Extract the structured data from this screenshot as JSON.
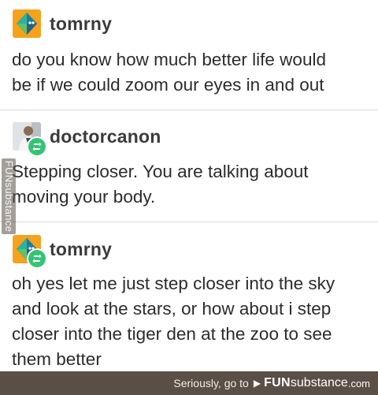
{
  "posts": [
    {
      "username": "tomrny",
      "lines": [
        "do you know how much better life would",
        "be if we could zoom our eyes in and out"
      ]
    },
    {
      "username": "doctorcanon",
      "lines": [
        "Stepping closer. You are talking about",
        "moving your body."
      ]
    },
    {
      "username": "tomrny",
      "lines": [
        "oh yes let me just step closer into the sky",
        "and look at the stars, or how about i step",
        "closer into the tiger den at the zoo to see",
        "them better"
      ]
    }
  ],
  "footer": {
    "caption": "Seriously, go to",
    "brand_fun": "FUN",
    "brand_sub": "substance",
    "brand_com": ".com"
  },
  "watermark": "FUNsubstance",
  "colors": {
    "avatar_orange": "#f5a21c",
    "reblog_green": "#35c474",
    "footer_bg": "#5a4f46"
  },
  "icons": {
    "avatar_tomrny": "octahedron-logo-icon",
    "reblog": "reblog-icon"
  }
}
